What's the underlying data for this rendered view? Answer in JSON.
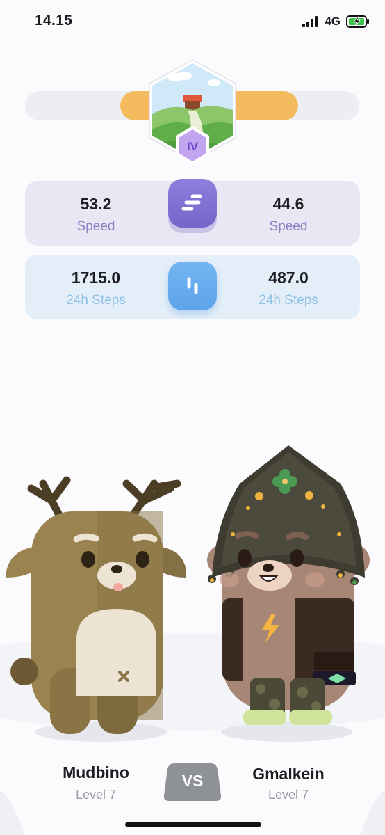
{
  "status_bar": {
    "time": "14.15",
    "network": "4G"
  },
  "badge": {
    "roman": "IV"
  },
  "stats": {
    "speed": {
      "left_value": "53.2",
      "right_value": "44.6",
      "label": "Speed"
    },
    "steps": {
      "left_value": "1715.0",
      "right_value": "487.0",
      "label": "24h Steps"
    }
  },
  "players": {
    "left": {
      "name": "Mudbino",
      "level": "Level 7"
    },
    "right": {
      "name": "Gmalkein",
      "level": "Level 7"
    }
  },
  "vs_label": "VS",
  "colors": {
    "progress": "#f3bb5e",
    "speed_accent": "#7a6dd1",
    "steps_accent": "#66acee",
    "badge_purple": "#c2a5ef"
  }
}
